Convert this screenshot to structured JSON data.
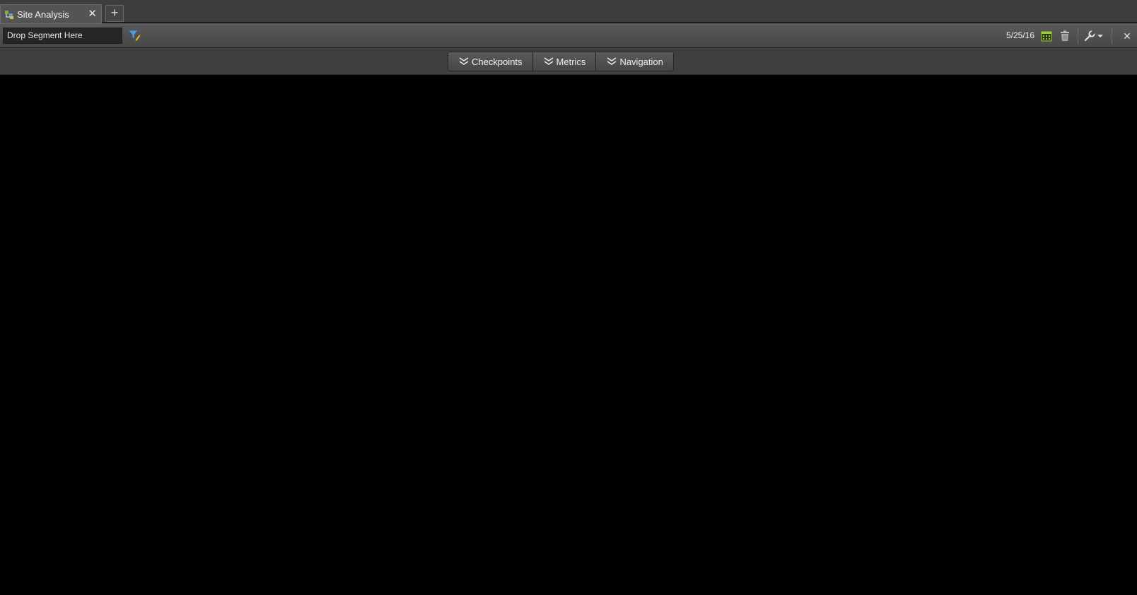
{
  "tabs": [
    {
      "label": "Site Analysis",
      "icon": "site-analysis-icon"
    }
  ],
  "new_tab_label": "+",
  "toolbar": {
    "segment_drop_label": "Drop Segment Here",
    "date": "5/25/16"
  },
  "buttonbar": {
    "buttons": [
      {
        "label": "Checkpoints",
        "icon": "double-chevron-down-icon"
      },
      {
        "label": "Metrics",
        "icon": "double-chevron-down-icon"
      },
      {
        "label": "Navigation",
        "icon": "double-chevron-down-icon"
      }
    ]
  },
  "colors": {
    "canvas_background": "#000000",
    "chrome_background": "#3d3d3d",
    "calendar_accent": "#9acd32",
    "filter_accent": "#5b9bd5"
  }
}
